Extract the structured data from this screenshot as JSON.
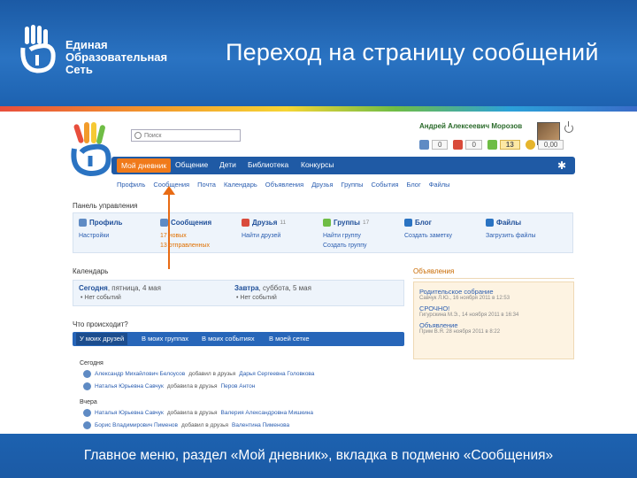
{
  "slide": {
    "logo_lines": [
      "Единая",
      "Образовательная",
      "Сеть"
    ],
    "title": "Переход на страницу сообщений",
    "caption": "Главное меню, раздел «Мой дневник», вкладка в подменю «Сообщения»"
  },
  "colors": {
    "header_blue": "#1b5aa5",
    "nav_blue": "#1f5aa5",
    "active_orange": "#f07a1a",
    "arrow_orange": "#e86b14",
    "panel_bg": "#eef4fb",
    "ann_bg": "#fdf3e2"
  },
  "site": {
    "search_placeholder": "Поиск",
    "user_name": "Андрей Алексеевич Морозов",
    "counters": [
      {
        "value": "0",
        "icon": "messages-icon",
        "highlight": false
      },
      {
        "value": "0",
        "icon": "friends-icon",
        "highlight": false
      },
      {
        "value": "13",
        "icon": "groups-icon",
        "highlight": true
      },
      {
        "value": "0,00",
        "icon": "coins-icon",
        "highlight": false
      }
    ],
    "main_nav": [
      "Мой дневник",
      "Общение",
      "Дети",
      "Библиотека",
      "Конкурсы"
    ],
    "sub_nav": [
      "Профиль",
      "Сообщения",
      "Почта",
      "Календарь",
      "Объявления",
      "Друзья",
      "Группы",
      "События",
      "Блог",
      "Файлы"
    ],
    "panel_title": "Панель управления",
    "panel": [
      {
        "title": "Профиль",
        "icon": "profile-icon",
        "count": "",
        "links": [
          "Настройки"
        ]
      },
      {
        "title": "Сообщения",
        "icon": "messages-icon",
        "count": "",
        "links": [
          "17 новых",
          "13 отправленных"
        ]
      },
      {
        "title": "Друзья",
        "icon": "friends-icon",
        "count": "11",
        "links": [
          "Найти друзей"
        ]
      },
      {
        "title": "Группы",
        "icon": "groups-icon",
        "count": "17",
        "links": [
          "Найти группу",
          "Создать группу"
        ]
      },
      {
        "title": "Блог",
        "icon": "blog-icon",
        "count": "",
        "links": [
          "Создать заметку"
        ]
      },
      {
        "title": "Файлы",
        "icon": "files-icon",
        "count": "",
        "links": [
          "Загрузить файлы"
        ]
      }
    ],
    "calendar_title": "Календарь",
    "calendar": [
      {
        "day": "Сегодня",
        "rest": ", пятница, 4 мая",
        "event": "Нет событий"
      },
      {
        "day": "Завтра",
        "rest": ", суббота, 5 мая",
        "event": "Нет событий"
      }
    ],
    "announcements_title": "Объявления",
    "announcements": [
      {
        "title": "Родительское собрание",
        "meta": "Савчук Л.Ю., 16 ноября 2011 в 12:53"
      },
      {
        "title": "СРОЧНО!",
        "meta": "Гигурскина М.Э., 14 ноября 2011 в 16:34"
      },
      {
        "title": "Объявление",
        "meta": "Прим В.Я. 28 ноября 2011 в 8:22"
      }
    ],
    "whats_happening": "Что происходит?",
    "feed_tabs": [
      "У моих друзей",
      "В моих группах",
      "В моих событиях",
      "В моей сетке"
    ],
    "feed": [
      {
        "group": "Сегодня",
        "rows": [
          {
            "link": "Александр Михайлович Белоусов",
            "text": " добавил в друзья ",
            "link2": "Дарья Сергеевна Головкова"
          },
          {
            "link": "Наталья Юрьевна Савчук",
            "text": " добавила в друзья ",
            "link2": "Перов Антон"
          }
        ]
      },
      {
        "group": "Вчера",
        "rows": [
          {
            "link": "Наталья Юрьевна Савчук",
            "text": " добавила в друзья ",
            "link2": "Валерия Александровна Мишкина"
          },
          {
            "link": "Борис Владимирович Пименов",
            "text": " добавил в друзья ",
            "link2": "Валентина Пименова"
          }
        ]
      }
    ]
  }
}
